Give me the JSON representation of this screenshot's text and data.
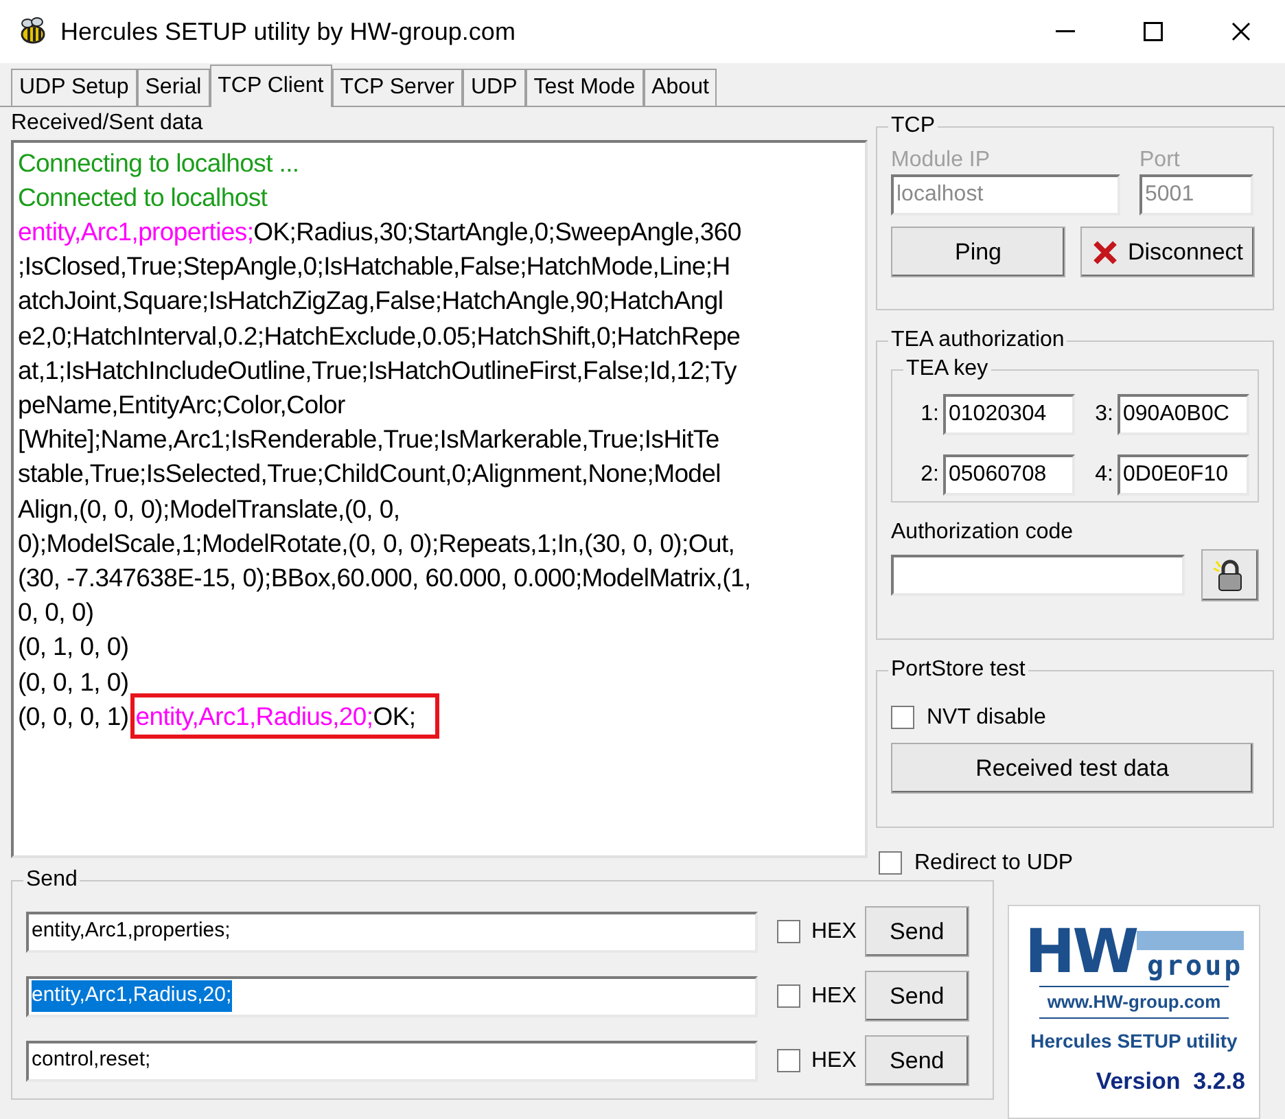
{
  "window": {
    "title": "Hercules SETUP utility by HW-group.com"
  },
  "tabs": [
    {
      "label": "UDP Setup",
      "selected": false
    },
    {
      "label": "Serial",
      "selected": false
    },
    {
      "label": "TCP Client",
      "selected": true
    },
    {
      "label": "TCP Server",
      "selected": false
    },
    {
      "label": "UDP",
      "selected": false
    },
    {
      "label": "Test Mode",
      "selected": false
    },
    {
      "label": "About",
      "selected": false
    }
  ],
  "log": {
    "label": "Received/Sent data",
    "lines": [
      {
        "segments": [
          {
            "kind": "status",
            "text": "Connecting to localhost ..."
          }
        ]
      },
      {
        "segments": [
          {
            "kind": "status",
            "text": "Connected to localhost"
          }
        ]
      },
      {
        "segments": [
          {
            "kind": "sent",
            "text": "entity,Arc1,properties;"
          },
          {
            "kind": "received",
            "text": "OK;Radius,30;StartAngle,0;SweepAngle,360"
          }
        ]
      },
      {
        "segments": [
          {
            "kind": "received",
            "text": ";IsClosed,True;StepAngle,0;IsHatchable,False;HatchMode,Line;H"
          }
        ]
      },
      {
        "segments": [
          {
            "kind": "received",
            "text": "atchJoint,Square;IsHatchZigZag,False;HatchAngle,90;HatchAngl"
          }
        ]
      },
      {
        "segments": [
          {
            "kind": "received",
            "text": "e2,0;HatchInterval,0.2;HatchExclude,0.05;HatchShift,0;HatchRepe"
          }
        ]
      },
      {
        "segments": [
          {
            "kind": "received",
            "text": "at,1;IsHatchIncludeOutline,True;IsHatchOutlineFirst,False;Id,12;Ty"
          }
        ]
      },
      {
        "segments": [
          {
            "kind": "received",
            "text": "peName,EntityArc;Color,Color"
          }
        ]
      },
      {
        "segments": [
          {
            "kind": "received",
            "text": "[White];Name,Arc1;IsRenderable,True;IsMarkerable,True;IsHitTe"
          }
        ]
      },
      {
        "segments": [
          {
            "kind": "received",
            "text": "stable,True;IsSelected,True;ChildCount,0;Alignment,None;Model"
          }
        ]
      },
      {
        "segments": [
          {
            "kind": "received",
            "text": "Align,(0, 0, 0);ModelTranslate,(0, 0,"
          }
        ]
      },
      {
        "segments": [
          {
            "kind": "received",
            "text": "0);ModelScale,1;ModelRotate,(0, 0, 0);Repeats,1;In,(30, 0, 0);Out,"
          }
        ]
      },
      {
        "segments": [
          {
            "kind": "received",
            "text": "(30, -7.347638E-15, 0);BBox,60.000, 60.000, 0.000;ModelMatrix,(1,"
          }
        ]
      },
      {
        "segments": [
          {
            "kind": "received",
            "text": "0, 0, 0)"
          }
        ]
      },
      {
        "segments": [
          {
            "kind": "received",
            "text": "(0, 1, 0, 0)"
          }
        ]
      },
      {
        "segments": [
          {
            "kind": "received",
            "text": "(0, 0, 1, 0)"
          }
        ]
      },
      {
        "segments": [
          {
            "kind": "received",
            "text": "(0, 0, 0, 1)"
          }
        ],
        "highlighted": [
          {
            "kind": "sent",
            "text": "entity,Arc1,Radius,20;"
          },
          {
            "kind": "received",
            "text": "OK;"
          }
        ]
      }
    ]
  },
  "tcp": {
    "title": "TCP",
    "module_ip": {
      "label": "Module IP",
      "value": "localhost",
      "disabled": true
    },
    "port": {
      "label": "Port",
      "value": "5001",
      "disabled": true
    },
    "ping": "Ping",
    "disconnect": "Disconnect"
  },
  "tea": {
    "title": "TEA authorization",
    "key_title": "TEA key",
    "keys": [
      {
        "label": "1:",
        "value": "01020304"
      },
      {
        "label": "3:",
        "value": "090A0B0C"
      },
      {
        "label": "2:",
        "value": "05060708"
      },
      {
        "label": "4:",
        "value": "0D0E0F10"
      }
    ],
    "auth_label": "Authorization code"
  },
  "portstore": {
    "title": "PortStore test",
    "nvt": {
      "label": "NVT disable",
      "checked": false
    },
    "button": "Received test data"
  },
  "redirect": {
    "label": "Redirect to UDP",
    "checked": false
  },
  "send": {
    "title": "Send",
    "rows": [
      {
        "value": "entity,Arc1,properties;",
        "selected": false,
        "hex": {
          "label": "HEX",
          "checked": false
        },
        "button": "Send"
      },
      {
        "value": "entity,Arc1,Radius,20;",
        "selected": true,
        "hex": {
          "label": "HEX",
          "checked": false
        },
        "button": "Send"
      },
      {
        "value": "control,reset;",
        "selected": false,
        "hex": {
          "label": "HEX",
          "checked": false
        },
        "button": "Send"
      }
    ]
  },
  "logo": {
    "mark_left": "HW",
    "mark_right": "group",
    "url": "www.HW-group.com",
    "product": "Hercules SETUP utility",
    "version": "Version  3.2.8"
  }
}
